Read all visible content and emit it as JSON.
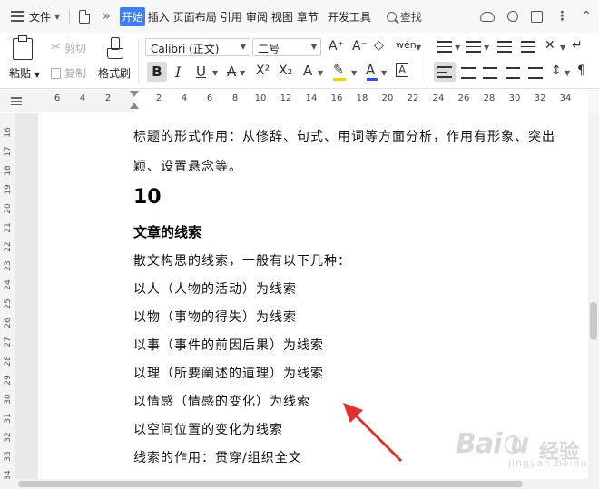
{
  "menubar": {
    "file_label": "文件",
    "tabs": [
      "开始",
      "插入",
      "页面布局",
      "引用",
      "审阅",
      "视图",
      "章节"
    ],
    "dev_tab": "开发工具",
    "active_tab": "开始",
    "search_label": "查找"
  },
  "ribbon": {
    "paste_label": "粘贴",
    "cut_label": "剪切",
    "copy_label": "复制",
    "format_painter_label": "格式刷",
    "font_name": "Calibri (正文)",
    "font_size": "二号",
    "bold_label": "B",
    "italic_label": "I",
    "underline_label": "U",
    "font_color_label": "A",
    "superscript_label": "X²",
    "subscript_label": "X₂",
    "grow_font_label": "A⁺",
    "shrink_font_label": "A⁻",
    "text_effect_label": "A",
    "char_border_label": "A",
    "phonetic_label": "wén",
    "font_color_hex": "#2f54eb",
    "highlight_color_hex": "#f5d000",
    "active_tab_color": "#3f7ef0"
  },
  "ruler": {
    "ticks": [
      "6",
      "4",
      "2",
      "2",
      "4",
      "6",
      "8",
      "10",
      "12",
      "14",
      "16",
      "18",
      "20",
      "22",
      "24",
      "26",
      "28",
      "30",
      "32",
      "34"
    ],
    "vticks": [
      "16",
      "17",
      "18",
      "19",
      "20",
      "21",
      "22",
      "23",
      "24",
      "25",
      "26",
      "27",
      "28",
      "29",
      "30",
      "31",
      "32",
      "33",
      "34"
    ]
  },
  "document": {
    "line1": "标题的形式作用：从修辞、句式、用词等方面分析，作用有形象、突出",
    "line2": "颖、设置悬念等。",
    "heading_number": "10",
    "heading": "文章的线索",
    "body": [
      "散文构思的线索，一般有以下几种：",
      "以人（人物的活动）为线索",
      "以物（事物的得失）为线索",
      "以事（事件的前因后果）为线索",
      "以理（所要阐述的道理）为线索",
      "以情感（情感的变化）为线索",
      "以空间位置的变化为线索",
      "线索的作用：贯穿/组织全文"
    ]
  },
  "watermark": {
    "logo": "Bai  u",
    "sub": "jingyan.baidu.com",
    "label": "经验"
  },
  "annotation": {
    "arrow_color": "#e03030"
  }
}
